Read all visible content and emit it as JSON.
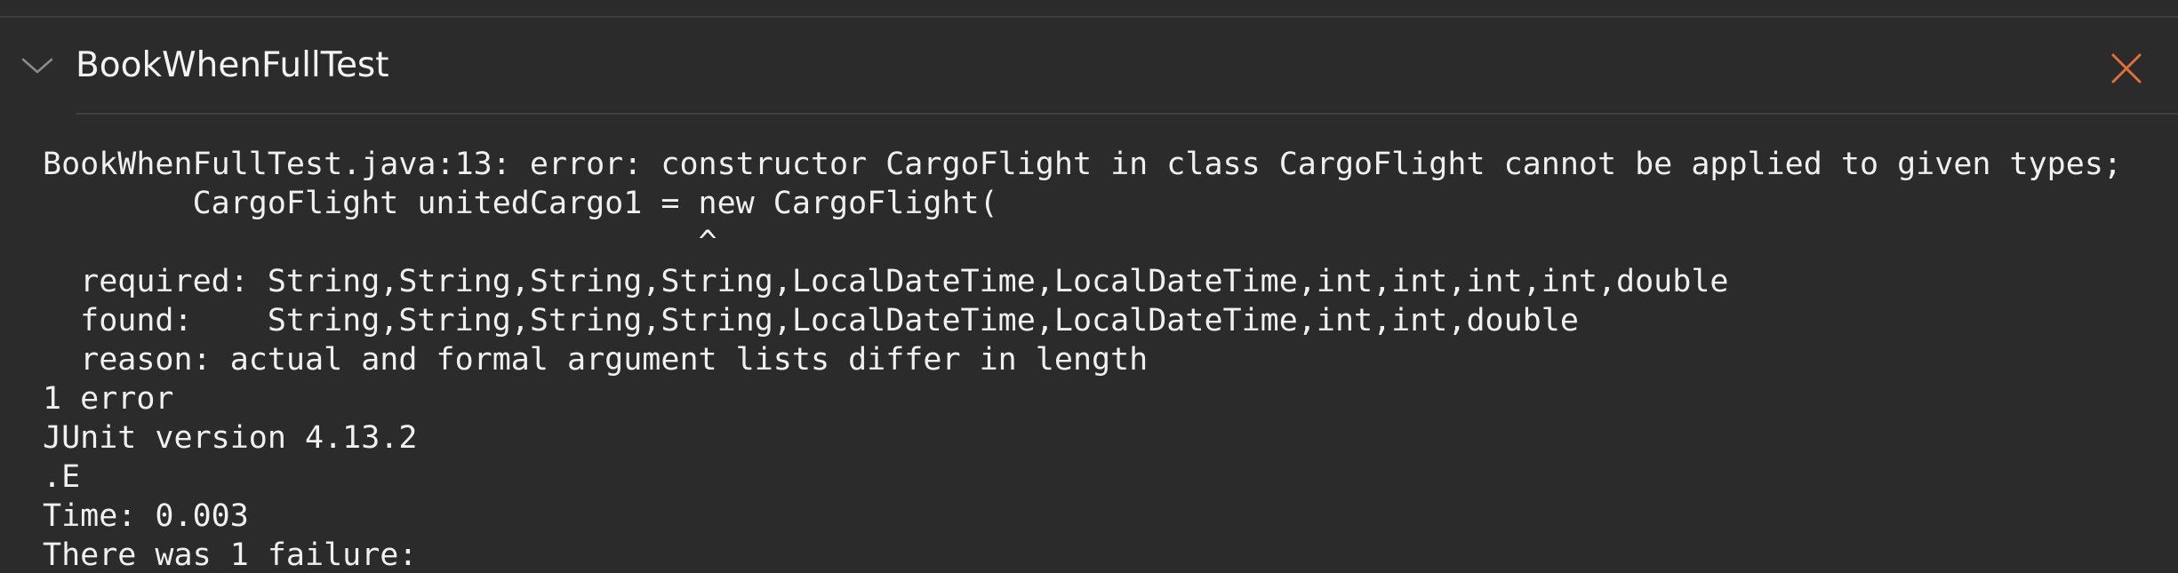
{
  "panel": {
    "title": "BookWhenFullTest",
    "accent_color": "#e0703a",
    "icons": {
      "collapse": "chevron-down-icon",
      "close": "close-icon"
    }
  },
  "console": {
    "lines": [
      "BookWhenFullTest.java:13: error: constructor CargoFlight in class CargoFlight cannot be applied to given types;",
      "        CargoFlight unitedCargo1 = new CargoFlight(",
      "                                   ^",
      "  required: String,String,String,String,LocalDateTime,LocalDateTime,int,int,int,int,double",
      "  found:    String,String,String,String,LocalDateTime,LocalDateTime,int,int,double",
      "  reason: actual and formal argument lists differ in length",
      "1 error",
      "JUnit version 4.13.2",
      ".E",
      "Time: 0.003",
      "There was 1 failure:"
    ]
  }
}
